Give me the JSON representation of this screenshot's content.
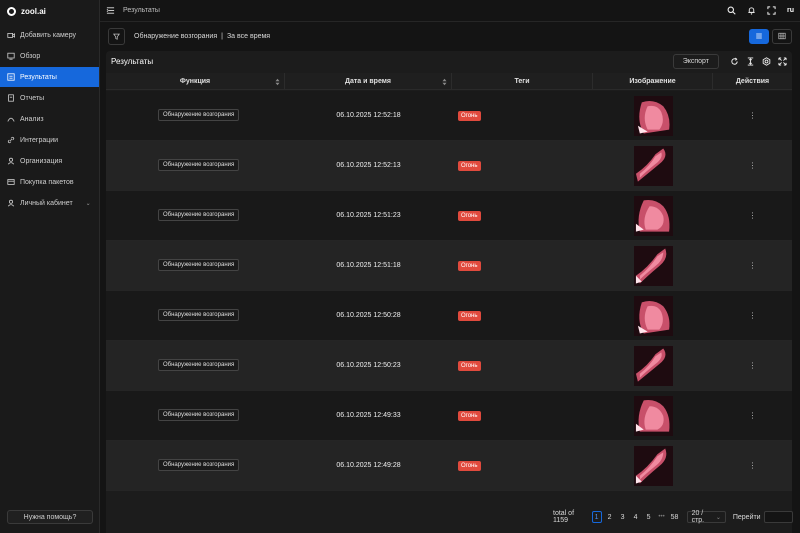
{
  "app": {
    "brand": "zool.ai"
  },
  "sidebar": {
    "items": [
      {
        "label": "Добавить камеру",
        "icon": "camera-icon",
        "active": false
      },
      {
        "label": "Обзор",
        "icon": "monitor-icon",
        "active": false
      },
      {
        "label": "Результаты",
        "icon": "results-icon",
        "active": true
      },
      {
        "label": "Отчеты",
        "icon": "report-icon",
        "active": false
      },
      {
        "label": "Анализ",
        "icon": "analysis-icon",
        "active": false
      },
      {
        "label": "Интеграции",
        "icon": "link-icon",
        "active": false
      },
      {
        "label": "Организация",
        "icon": "organization-icon",
        "active": false
      },
      {
        "label": "Покупка пакетов",
        "icon": "cart-icon",
        "active": false
      },
      {
        "label": "Личный кабинет",
        "icon": "user-icon",
        "active": false
      }
    ],
    "help_label": "Нужна помощь?"
  },
  "header": {
    "breadcrumb": "Результаты",
    "lang": "ru"
  },
  "filters": {
    "function": "Обнаружение возгорания",
    "separator": "|",
    "period": "За все время"
  },
  "card": {
    "title": "Результаты",
    "export_label": "Экспорт"
  },
  "table": {
    "columns": [
      "Функция",
      "Дата и время",
      "Теги",
      "Изображение",
      "Действия"
    ],
    "rows": [
      {
        "function": "Обнаружение возгорания",
        "datetime": "06.10.2025 12:52:18",
        "tag": "Огонь",
        "actions": "⋮"
      },
      {
        "function": "Обнаружение возгорания",
        "datetime": "06.10.2025 12:52:13",
        "tag": "Огонь",
        "actions": "⋮"
      },
      {
        "function": "Обнаружение возгорания",
        "datetime": "06.10.2025 12:51:23",
        "tag": "Огонь",
        "actions": "⋮"
      },
      {
        "function": "Обнаружение возгорания",
        "datetime": "06.10.2025 12:51:18",
        "tag": "Огонь",
        "actions": "⋮"
      },
      {
        "function": "Обнаружение возгорания",
        "datetime": "06.10.2025 12:50:28",
        "tag": "Огонь",
        "actions": "⋮"
      },
      {
        "function": "Обнаружение возгорания",
        "datetime": "06.10.2025 12:50:23",
        "tag": "Огонь",
        "actions": "⋮"
      },
      {
        "function": "Обнаружение возгорания",
        "datetime": "06.10.2025 12:49:33",
        "tag": "Огонь",
        "actions": "⋮"
      },
      {
        "function": "Обнаружение возгорания",
        "datetime": "06.10.2025 12:49:28",
        "tag": "Огонь",
        "actions": "⋮"
      }
    ]
  },
  "pagination": {
    "total_label": "total of 1159",
    "pages": [
      "1",
      "2",
      "3",
      "4",
      "5"
    ],
    "ellipsis": "•••",
    "last": "58",
    "current": "1",
    "per_page": "20 / стр.",
    "goto_label": "Перейти"
  },
  "colors": {
    "accent": "#1668dc",
    "fire_tag": "#e04a3d",
    "background": "#141414"
  }
}
